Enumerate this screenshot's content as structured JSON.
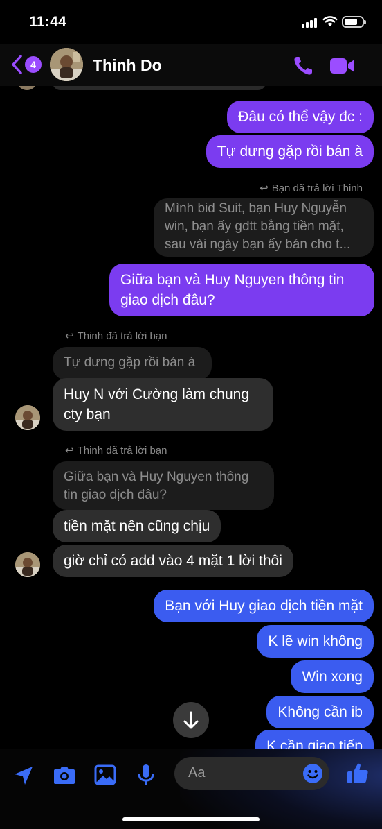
{
  "status": {
    "time": "11:44"
  },
  "header": {
    "back_count": "4",
    "contact_name": "Thinh Do"
  },
  "messages": {
    "out1": "Đâu có thể vậy đc :",
    "out2": "Tự dưng gặp rồi bán à",
    "reply_note_1": "Bạn đã trả lời Thinh",
    "quote1": [
      "Mình bid Suit, bạn Huy Nguyễn",
      "win, bạn ấy gdtt bằng tiền mặt,",
      "sau vài ngày bạn ấy bán cho t..."
    ],
    "out3": [
      "Giữa bạn và Huy Nguyen thông tin",
      "giao dịch đâu?"
    ],
    "reply_note_2": "Thinh đã trả lời bạn",
    "quote2": "Tự dưng gặp rồi bán à",
    "in1": [
      "Huy N với Cường làm chung",
      "cty bạn"
    ],
    "reply_note_3": "Thinh đã trả lời bạn",
    "quote3": [
      "Giữa bạn và Huy Nguyen thông",
      "tin giao dịch đâu?"
    ],
    "in2": "tiền mặt nên cũng chịu",
    "in3": "giờ chỉ có add vào 4 mặt 1 lời thôi",
    "out4": "Bạn với Huy giao dịch tiền mặt",
    "out5": "K lẽ win không",
    "out6": "Win xong",
    "out7": "Không cần ib",
    "out8": "K cần giao tiếp"
  },
  "composer": {
    "placeholder": "Aa"
  },
  "colors": {
    "accent": "#9b4dff",
    "outgoing_purple": "#7b3cf0",
    "outgoing_blue": "#3b5cf0",
    "incoming": "#2e2e2e"
  }
}
